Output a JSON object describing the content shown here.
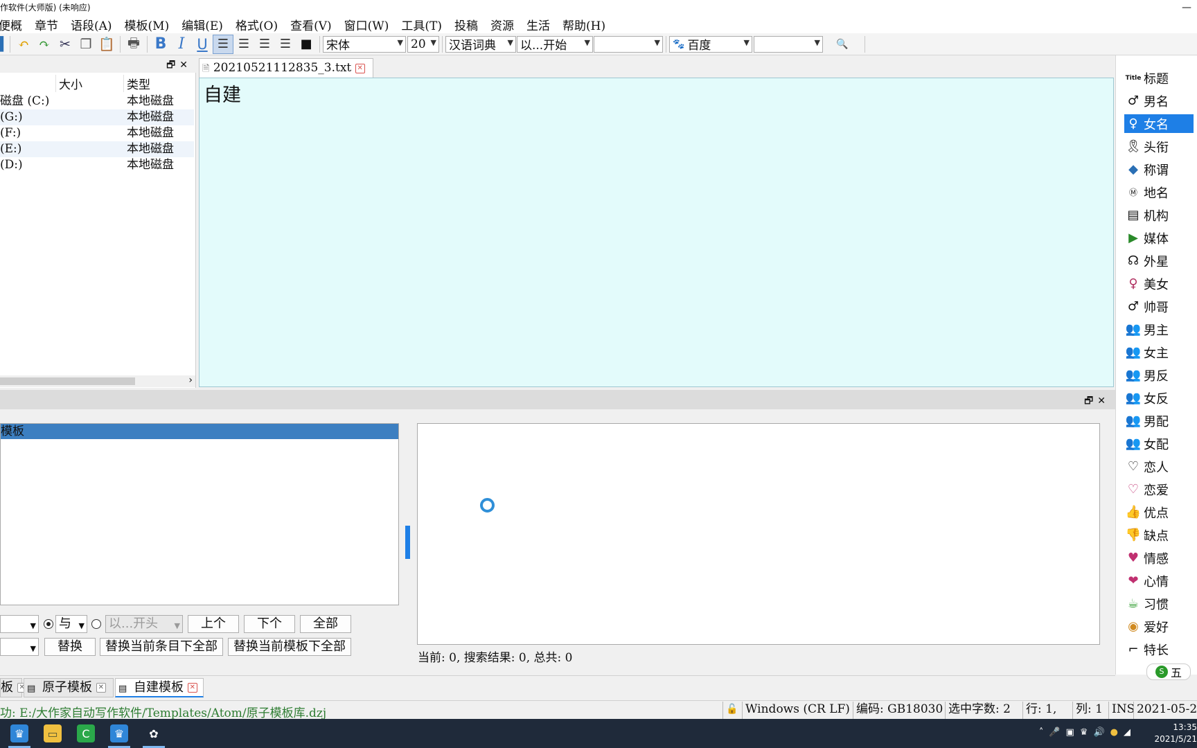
{
  "window": {
    "title": "作软件(大师版) (未响应)"
  },
  "menu": [
    "便概",
    "章节",
    "语段(A)",
    "模板(M)",
    "编辑(E)",
    "格式(O)",
    "查看(V)",
    "窗口(W)",
    "工具(T)",
    "投稿",
    "资源",
    "生活",
    "帮助(H)"
  ],
  "toolbar": {
    "font_name": "宋体",
    "font_size": "20",
    "dictionary": "汉语词典",
    "match_mode": "以...开始",
    "search_engine": "百度",
    "bold_glyph": "B",
    "italic_glyph": "I",
    "underline_glyph": "U",
    "icons": [
      "save-icon",
      "undo-icon",
      "redo-icon",
      "cut-icon",
      "copy-icon",
      "paste-icon",
      "print-icon",
      "bold-icon",
      "italic-icon",
      "underline-icon",
      "align-left-icon",
      "align-center-icon",
      "align-right-icon",
      "justify-icon",
      "text-color-icon",
      "search-icon"
    ]
  },
  "file_panel": {
    "columns": {
      "size": "大小",
      "type": "类型"
    },
    "rows": [
      {
        "name": "磁盘 (C:)",
        "type": "本地磁盘"
      },
      {
        "name": "(G:)",
        "type": "本地磁盘"
      },
      {
        "name": "(F:)",
        "type": "本地磁盘"
      },
      {
        "name": "(E:)",
        "type": "本地磁盘"
      },
      {
        "name": "(D:)",
        "type": "本地磁盘"
      }
    ]
  },
  "editor": {
    "tab_title": "20210521112835_3.txt",
    "content": "自建"
  },
  "tags": [
    {
      "label": "标题",
      "icon": "title-icon"
    },
    {
      "label": "男名",
      "icon": "male-name-icon"
    },
    {
      "label": "女名",
      "icon": "female-name-icon",
      "selected": true
    },
    {
      "label": "头衔",
      "icon": "ribbon-icon"
    },
    {
      "label": "称谓",
      "icon": "tag-icon"
    },
    {
      "label": "地名",
      "icon": "place-icon"
    },
    {
      "label": "机构",
      "icon": "organization-icon"
    },
    {
      "label": "媒体",
      "icon": "media-icon"
    },
    {
      "label": "外星",
      "icon": "alien-icon"
    },
    {
      "label": "美女",
      "icon": "female-icon"
    },
    {
      "label": "帅哥",
      "icon": "male-icon"
    },
    {
      "label": "男主",
      "icon": "group-icon"
    },
    {
      "label": "女主",
      "icon": "group-icon"
    },
    {
      "label": "男反",
      "icon": "group-icon"
    },
    {
      "label": "女反",
      "icon": "group-icon"
    },
    {
      "label": "男配",
      "icon": "group-icon"
    },
    {
      "label": "女配",
      "icon": "group-icon"
    },
    {
      "label": "恋人",
      "icon": "heart-icon"
    },
    {
      "label": "恋爱",
      "icon": "hearts-icon"
    },
    {
      "label": "优点",
      "icon": "thumbs-up-icon"
    },
    {
      "label": "缺点",
      "icon": "thumbs-down-icon"
    },
    {
      "label": "情感",
      "icon": "person-heart-icon"
    },
    {
      "label": "心情",
      "icon": "mood-heart-icon"
    },
    {
      "label": "习惯",
      "icon": "teacup-icon"
    },
    {
      "label": "爱好",
      "icon": "hobby-icon"
    },
    {
      "label": "特长",
      "icon": "stairs-icon"
    }
  ],
  "ime": {
    "label": "五"
  },
  "lower": {
    "selected_item": "模板",
    "and_option": "与",
    "start_option": "以...开头",
    "prev_button": "上个",
    "next_button": "下个",
    "all_button": "全部",
    "replace_button": "替换",
    "replace_entry_button": "替换当前条目下全部",
    "replace_template_button": "替换当前模板下全部",
    "result_status": "当前: 0, 搜索结果: 0, 总共: 0"
  },
  "bottom_tabs": [
    {
      "label": "板",
      "active": false
    },
    {
      "label": "原子模板",
      "active": false
    },
    {
      "label": "自建模板",
      "active": true
    }
  ],
  "status": {
    "message": "功: E:/大作家自动写作软件/Templates/Atom/原子模板库.dzj",
    "line_ending": "Windows (CR LF)",
    "encoding": "编码: GB18030",
    "selected_chars": "选中字数: 2",
    "line": "行: 1,",
    "column": "列: 1",
    "mode": "INS",
    "date": "2021-05-2"
  },
  "taskbar": {
    "time": "13:35",
    "date": "2021/5/21",
    "apps": [
      "app-logo-icon",
      "file-explorer-icon",
      "editor-c-icon",
      "app-logo-icon",
      "flower-icon"
    ]
  }
}
